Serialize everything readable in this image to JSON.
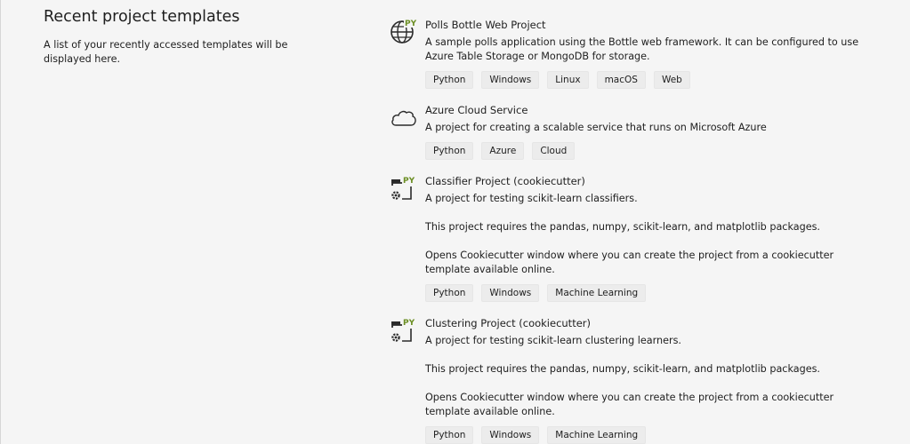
{
  "recent": {
    "title": "Recent project templates",
    "description": "A list of your recently accessed templates will be displayed here."
  },
  "templates": [
    {
      "icon": "globe-python-icon",
      "name": "Polls Bottle Web Project",
      "paragraphs": [
        "A sample polls application using the Bottle web framework. It can be configured to use Azure Table Storage or MongoDB for storage."
      ],
      "tags": [
        "Python",
        "Windows",
        "Linux",
        "macOS",
        "Web"
      ]
    },
    {
      "icon": "cloud-icon",
      "name": "Azure Cloud Service",
      "paragraphs": [
        "A project for creating a scalable service that runs on Microsoft Azure"
      ],
      "tags": [
        "Python",
        "Azure",
        "Cloud"
      ]
    },
    {
      "icon": "python-project-gear-icon",
      "name": "Classifier Project (cookiecutter)",
      "paragraphs": [
        "A project for testing scikit-learn classifiers.",
        "This project requires the pandas, numpy, scikit-learn, and matplotlib packages.",
        "Opens Cookiecutter window where you can create the project from a cookiecutter template available online."
      ],
      "tags": [
        "Python",
        "Windows",
        "Machine Learning"
      ]
    },
    {
      "icon": "python-project-gear-icon",
      "name": "Clustering Project (cookiecutter)",
      "paragraphs": [
        "A project for testing scikit-learn clustering learners.",
        "This project requires the pandas, numpy, scikit-learn, and matplotlib packages.",
        "Opens Cookiecutter window where you can create the project from a cookiecutter template available online."
      ],
      "tags": [
        "Python",
        "Windows",
        "Machine Learning"
      ]
    }
  ]
}
